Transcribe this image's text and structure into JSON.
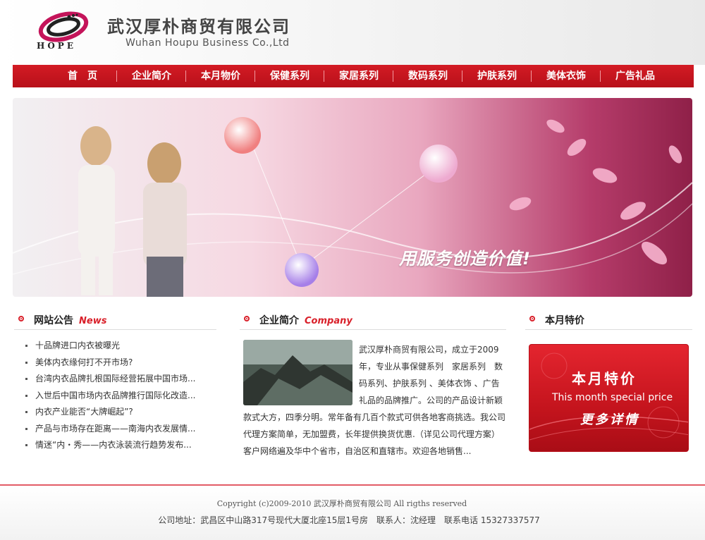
{
  "header": {
    "logo_text": "HOPE",
    "company_cn": "武汉厚朴商贸有限公司",
    "company_en": "Wuhan Houpu Business Co.,Ltd"
  },
  "nav": {
    "items": [
      {
        "label": "首　页"
      },
      {
        "label": "企业简介"
      },
      {
        "label": "本月物价"
      },
      {
        "label": "保健系列"
      },
      {
        "label": "家居系列"
      },
      {
        "label": "数码系列"
      },
      {
        "label": "护肤系列"
      },
      {
        "label": "美体衣饰"
      },
      {
        "label": "广告礼品"
      }
    ]
  },
  "banner": {
    "slogan": "用服务创造价值!"
  },
  "news": {
    "title": "网站公告",
    "title_en": "News",
    "items": [
      "十品牌进口内衣被曝光",
      "美体内衣缘何打不开市场?",
      "台湾内衣品牌扎根国际经营拓展中国市场...",
      "入世后中国市场内衣品牌推行国际化改造...",
      "内衣产业能否“大牌崛起”?",
      "产品与市场存在距离——南海内衣发展情...",
      "情迷“内・秀——内衣泳装流行趋势发布..."
    ]
  },
  "company": {
    "title": "企业简介",
    "title_en": "Company",
    "text": "武汉厚朴商贸有限公司，成立于2009年，专业从事保健系列　家居系列　数码系列、护肤系列 、美体衣饰 、广告礼品的品牌推广。公司的产品设计新颖款式大方，四季分明。常年备有几百个款式可供各地客商挑选。我公司代理方案简单，无加盟费，长年提供换货优惠.（详见公司代理方案）客户网络遍及华中个省市，自治区和直辖市。欢迎各地销售..."
  },
  "special": {
    "title": "本月特价",
    "banner_cn": "本月特价",
    "banner_en": "This month special price",
    "banner_more": "更多详情"
  },
  "footer": {
    "copyright": "Copyright (c)2009-2010 武汉厚朴商贸有限公司 All rigths reserved",
    "address": "公司地址：武昌区中山路317号现代大厦北座15层1号房　联系人：沈经理　联系电话 15327337577"
  },
  "colors": {
    "accent": "#d9202a",
    "nav_bg": "#c4141d"
  }
}
